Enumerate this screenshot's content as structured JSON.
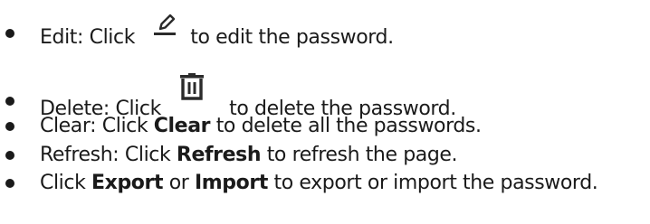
{
  "items": [
    {
      "label": "Edit:",
      "pre": "Click",
      "post": "to edit the password.",
      "icon": "pencil-edit-icon"
    },
    {
      "label": "Delete:",
      "pre": "Click",
      "post": "to delete the password.",
      "icon": "trash-delete-icon"
    },
    {
      "label": "Clear:",
      "pre": "Click",
      "button": "Clear",
      "post": "to delete all the passwords."
    },
    {
      "label": "Refresh:",
      "pre": "Click",
      "button": "Refresh",
      "post": "to refresh the page."
    },
    {
      "pre": "Click",
      "button1": "Export",
      "mid": "or",
      "button2": "Import",
      "post": "to export or import the password."
    }
  ],
  "colors": {
    "text": "#1a1a1a",
    "icon": "#2b2b2b"
  }
}
